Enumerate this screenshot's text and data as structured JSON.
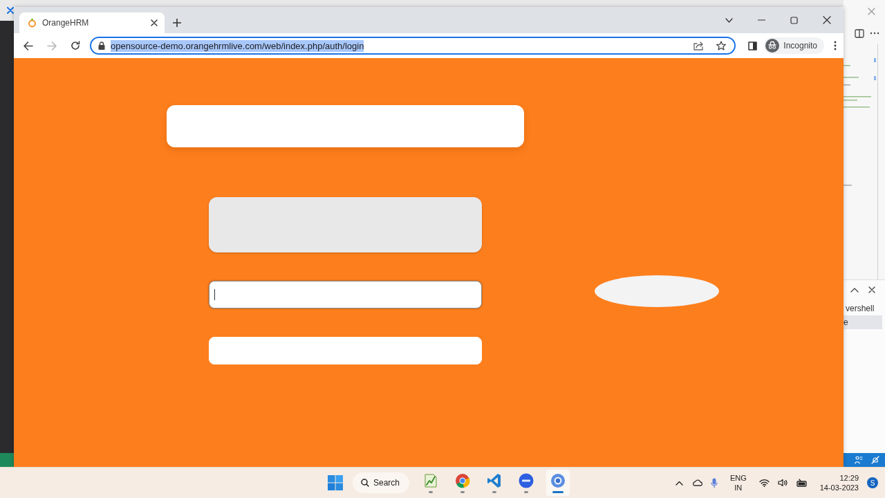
{
  "browser": {
    "tabs": [
      {
        "label": "OrangeHRM",
        "selected": true
      }
    ],
    "address": {
      "url": "opensource-demo.orangehrmlive.com/web/index.php/auth/login",
      "selected": true
    },
    "forward_disabled": true,
    "profile": "Incognito"
  },
  "page": {
    "fields": [
      {
        "focused": true
      },
      {
        "focused": false
      }
    ]
  },
  "background_window": {
    "panel_texts": [
      "vershell",
      "e"
    ]
  },
  "taskbar": {
    "search": "Search",
    "apps": [
      {
        "kind": "chart",
        "selected": false
      },
      {
        "kind": "chrome",
        "selected": false
      },
      {
        "kind": "code",
        "selected": false
      },
      {
        "kind": "meeting",
        "selected": false
      },
      {
        "kind": "browser",
        "selected": true
      }
    ],
    "language": [
      "ENG",
      "IN"
    ],
    "time": "12:29",
    "date": "14-03-2023",
    "account": "S"
  }
}
